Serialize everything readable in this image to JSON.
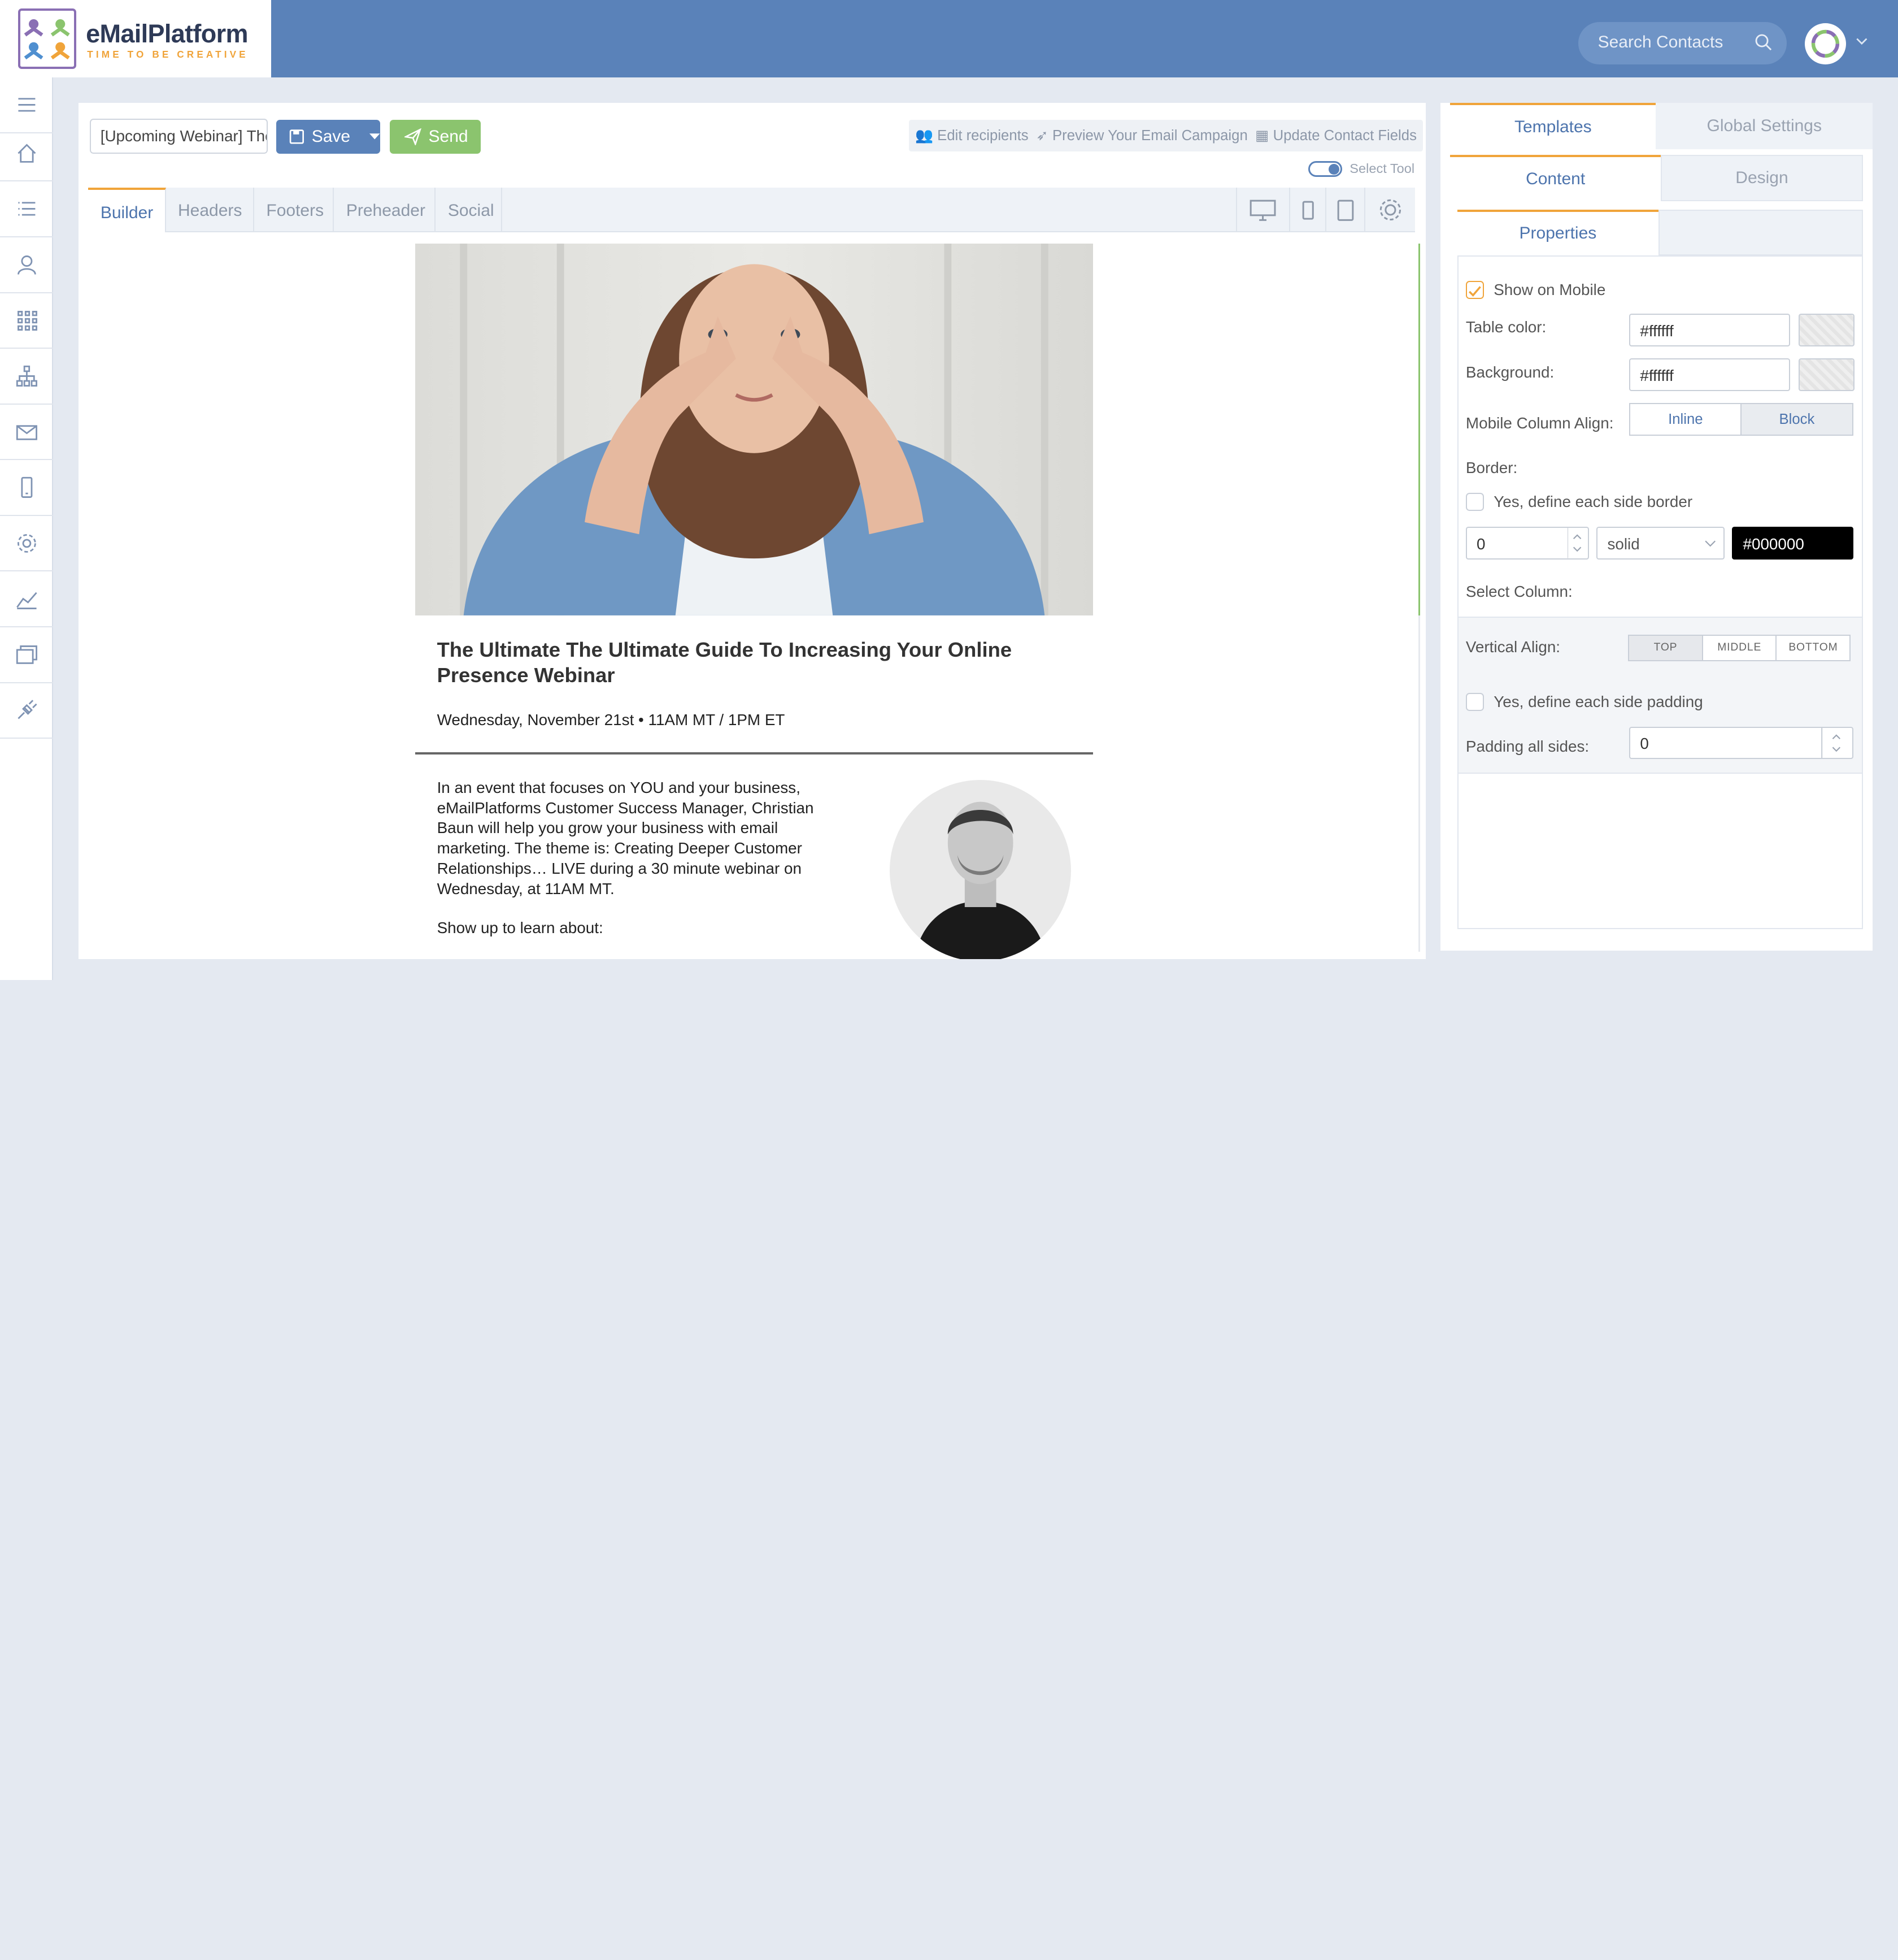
{
  "app": {
    "brand": "eMailPlatform",
    "tagline": "TIME TO BE CREATIVE"
  },
  "header": {
    "search_placeholder": "Search Contacts"
  },
  "nav": {
    "items": [
      "menu-icon",
      "home-icon",
      "list-icon",
      "contacts-icon",
      "apps-grid-icon",
      "sitemap-icon",
      "mail-icon",
      "mobile-icon",
      "settings-icon",
      "analytics-icon",
      "window-icon",
      "plug-icon"
    ]
  },
  "editor": {
    "subject_value": "[Upcoming Webinar] The Ultimate Guide",
    "save_label": "Save",
    "send_label": "Send",
    "edit_recipients": "Edit recipients",
    "preview": "Preview Your Email Campaign",
    "update_fields": "Update Contact Fields",
    "select_tool": "Select Tool",
    "tabs": [
      "Builder",
      "Headers",
      "Footers",
      "Preheader",
      "Social"
    ],
    "active_tab": "Builder"
  },
  "email": {
    "title": "The Ultimate The Ultimate Guide To Increasing Your Online Presence Webinar",
    "date": "Wednesday, November 21st • 11AM MT / 1PM ET",
    "body": "In an event that focuses on YOU and your business, eMailPlatforms Customer Success Manager, Christian Baun will help you grow your business with email marketing. The theme is: Creating Deeper Customer Relationships… LIVE during a 30 minute webinar on Wednesday, at 11AM MT.",
    "body2": "Show up to learn about:"
  },
  "panel": {
    "tab_templates": "Templates",
    "tab_global": "Global Settings",
    "tab_content": "Content",
    "tab_design": "Design",
    "tab_properties": "Properties",
    "show_on_mobile": "Show on Mobile",
    "show_on_mobile_checked": true,
    "table_color_label": "Table color:",
    "table_color": "#ffffff",
    "background_label": "Background:",
    "background": "#ffffff",
    "mobile_align_label": "Mobile Column Align:",
    "align_inline": "Inline",
    "align_block": "Block",
    "align_selected": "Block",
    "border_label": "Border:",
    "border_each_side": "Yes, define each side border",
    "border_width": "0",
    "border_style": "solid",
    "border_color": "#000000",
    "select_column_label": "Select Column:",
    "vertical_align_label": "Vertical Align:",
    "va_top": "TOP",
    "va_middle": "MIDDLE",
    "va_bottom": "BOTTOM",
    "va_selected": "TOP",
    "padding_each_side": "Yes, define each side padding",
    "padding_all_label": "Padding all sides:",
    "padding_all": "0"
  },
  "colors": {
    "header": "#5a82b9",
    "accent": "#f0a43a",
    "send": "#8bc46e",
    "brand_dark": "#2e3a57"
  }
}
